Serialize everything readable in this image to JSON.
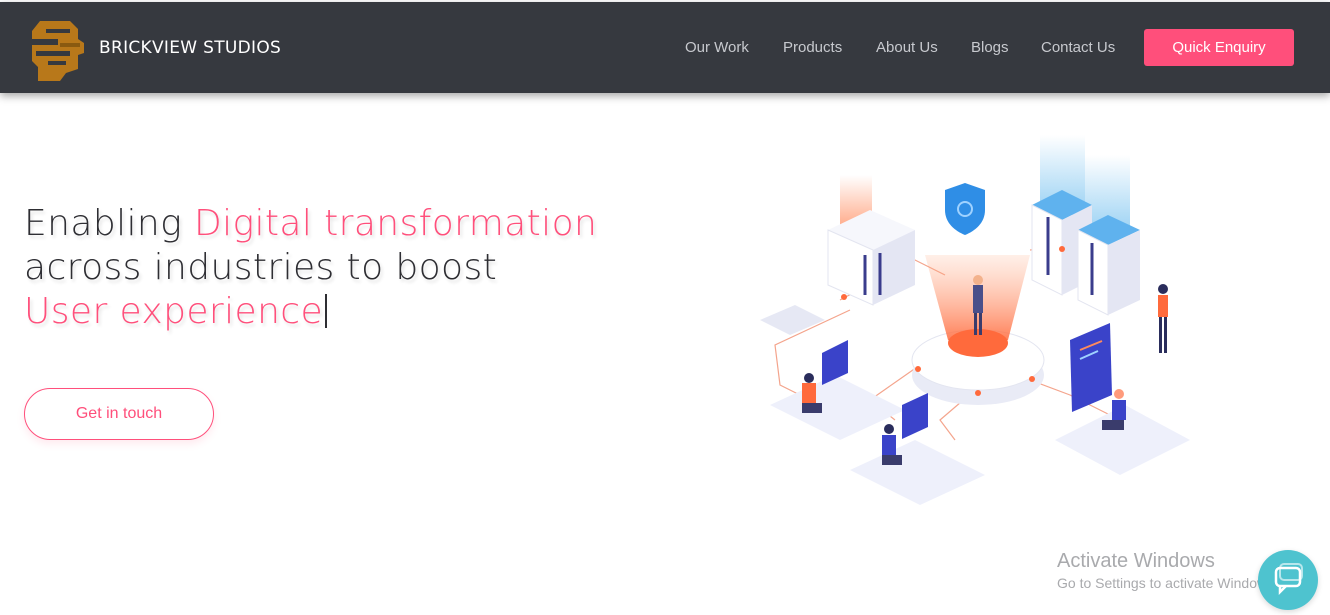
{
  "header": {
    "brand": "BRICKVIEW STUDIOS",
    "nav": [
      {
        "label": "Our Work"
      },
      {
        "label": "Products"
      },
      {
        "label": "About Us"
      },
      {
        "label": "Blogs"
      },
      {
        "label": "Contact Us"
      }
    ],
    "quick_enquiry": "Quick Enquiry"
  },
  "hero": {
    "line1_plain": "Enabling ",
    "line1_highlight": "Digital transformation",
    "line2": "across industries to boost",
    "line3_highlight": "User experience",
    "cta": "Get in touch"
  },
  "watermark": {
    "title": "Activate Windows",
    "subtitle": "Go to Settings to activate Windows."
  },
  "colors": {
    "navbar": "#36393f",
    "accent": "#ff4f7b",
    "chat": "#4ec3cf"
  }
}
